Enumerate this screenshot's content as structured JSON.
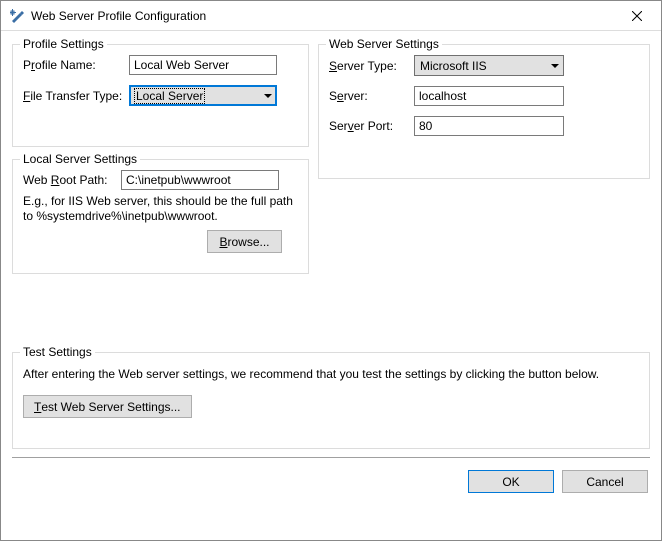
{
  "window": {
    "title": "Web Server Profile Configuration"
  },
  "profile": {
    "legend": "Profile Settings",
    "nameLabelPre": "P",
    "nameLabelU": "r",
    "nameLabelPost": "ofile Name:",
    "nameValue": "Local Web Server",
    "transferLabelPre": "",
    "transferLabelU": "F",
    "transferLabelPost": "ile Transfer Type:",
    "transferValue": "Local Server"
  },
  "webserver": {
    "legend": "Web Server Settings",
    "typeLabelPre": "",
    "typeLabelU": "S",
    "typeLabelPost": "erver Type:",
    "typeValue": "Microsoft IIS",
    "serverLabelPre": "S",
    "serverLabelU": "e",
    "serverLabelPost": "rver:",
    "serverValue": "localhost",
    "portLabelPre": "Ser",
    "portLabelU": "v",
    "portLabelPost": "er Port:",
    "portValue": "80"
  },
  "local": {
    "legend": "Local Server Settings",
    "rootLabelPre": "Web ",
    "rootLabelU": "R",
    "rootLabelPost": "oot Path:",
    "rootValue": "C:\\inetpub\\wwwroot",
    "hint": "E.g., for IIS Web server, this should be the full path to %systemdrive%\\inetpub\\wwwroot.",
    "browseLabelPre": "",
    "browseLabelU": "B",
    "browseLabelPost": "rowse..."
  },
  "test": {
    "legend": "Test Settings",
    "text": "After entering the Web server settings, we recommend that you test the settings by clicking the button below.",
    "buttonPre": "",
    "buttonU": "T",
    "buttonPost": "est Web Server Settings..."
  },
  "footer": {
    "ok": "OK",
    "cancel": "Cancel"
  }
}
